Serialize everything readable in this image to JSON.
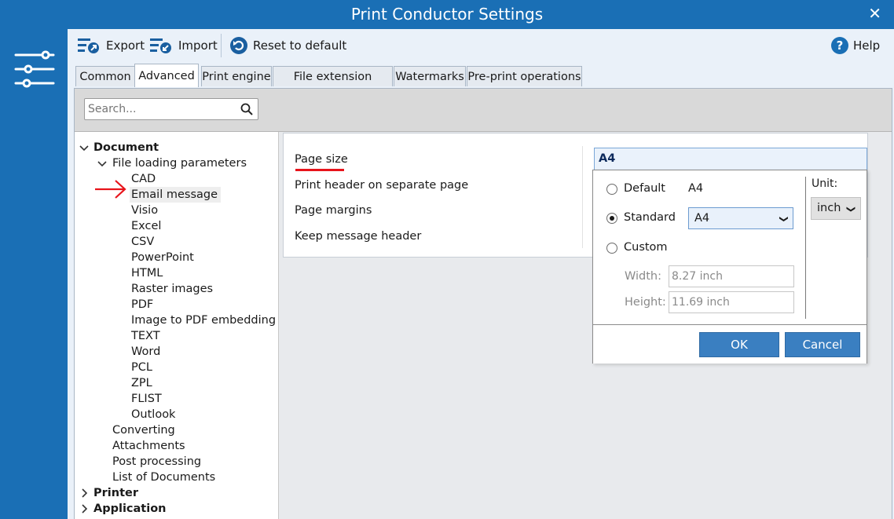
{
  "window": {
    "title": "Print Conductor Settings"
  },
  "toolbar": {
    "export": "Export",
    "import": "Import",
    "reset": "Reset to default",
    "help": "Help"
  },
  "tabs": [
    {
      "label": "Common",
      "active": false
    },
    {
      "label": "Advanced",
      "active": true
    },
    {
      "label": "Print engine",
      "active": false
    },
    {
      "label": "File extension aliases",
      "active": false
    },
    {
      "label": "Watermarks",
      "active": false
    },
    {
      "label": "Pre-print operations",
      "active": false
    }
  ],
  "search": {
    "placeholder": "Search..."
  },
  "tree": {
    "document": "Document",
    "file_loading": "File loading parameters",
    "file_types": [
      "CAD",
      "Email message",
      "Visio",
      "Excel",
      "CSV",
      "PowerPoint",
      "HTML",
      "Raster images",
      "PDF",
      "Image to PDF embedding",
      "TEXT",
      "Word",
      "PCL",
      "ZPL",
      "FLIST",
      "Outlook"
    ],
    "selected": "Email message",
    "doc_children": [
      "Converting",
      "Attachments",
      "Post processing",
      "List of Documents"
    ],
    "printer": "Printer",
    "application": "Application"
  },
  "settings": {
    "labels": [
      "Page size",
      "Print header on separate page",
      "Page margins",
      "Keep message header"
    ],
    "page_size_value": "A4"
  },
  "page_size_popup": {
    "default_label": "Default",
    "default_value": "A4",
    "standard_label": "Standard",
    "standard_value": "A4",
    "custom_label": "Custom",
    "selected_option": "Standard",
    "width_label": "Width:",
    "width_value": "8.27 inch",
    "height_label": "Height:",
    "height_value": "11.69 inch",
    "unit_label": "Unit:",
    "unit_value": "inch",
    "ok": "OK",
    "cancel": "Cancel"
  },
  "colors": {
    "brand": "#1a6fb5",
    "annotation": "#e8141b",
    "button": "#3a7fc1"
  }
}
